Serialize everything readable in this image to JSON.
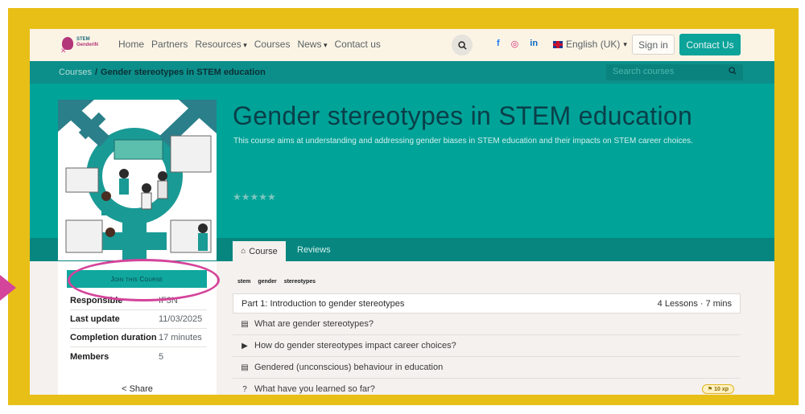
{
  "nav": {
    "logo_line1": "STEM",
    "logo_line2": "GenderIN",
    "menu": [
      "Home",
      "Partners",
      "Resources",
      "Courses",
      "News",
      "Contact us"
    ],
    "language": "English (UK)",
    "signin": "Sign in",
    "contact_button": "Contact Us",
    "social": {
      "facebook": "f",
      "instagram": "◎",
      "linkedin": "in"
    }
  },
  "breadcrumb": {
    "root": "Courses",
    "separator": "/",
    "current": "Gender stereotypes in STEM education",
    "search_placeholder": "Search courses"
  },
  "course": {
    "title": "Gender stereotypes in STEM education",
    "description": "This course aims at understanding and addressing gender biases in STEM education and their impacts on STEM career choices.",
    "rating_stars": "★★★★★",
    "rating_value": 0,
    "tabs": {
      "course": "Course",
      "reviews": "Reviews"
    },
    "join_button": "Join this Course",
    "info": [
      {
        "key": "Responsible",
        "value": "IF3N"
      },
      {
        "key": "Last update",
        "value": "11/03/2025"
      },
      {
        "key": "Completion duration",
        "value": "17 minutes"
      },
      {
        "key": "Members",
        "value": "5"
      }
    ],
    "share": "Share",
    "tags": [
      "stem",
      "gender",
      "stereotypes"
    ]
  },
  "section": {
    "title": "Part 1: Introduction to gender stereotypes",
    "meta": "4 Lessons · 7 mins",
    "lessons": [
      {
        "icon": "document-icon",
        "title": "What are gender stereotypes?"
      },
      {
        "icon": "video-icon",
        "title": "How do gender stereotypes impact career choices?"
      },
      {
        "icon": "document-icon",
        "title": "Gendered (unconscious) behaviour in education"
      },
      {
        "icon": "quiz-icon",
        "title": "What have you learned so far?",
        "badge": "10 xp"
      }
    ]
  },
  "colors": {
    "frame": "#e8bf17",
    "teal": "#00a398",
    "accent_pink": "#d4449b",
    "title": "#0a3f49"
  }
}
